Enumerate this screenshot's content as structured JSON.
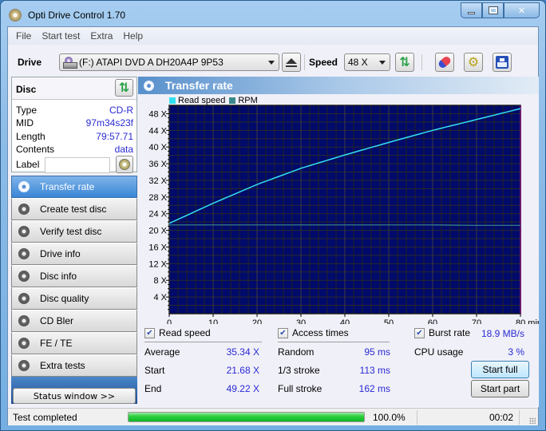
{
  "window": {
    "title": "Opti Drive Control 1.70",
    "controls": {
      "minimize": "minimize",
      "maximize": "maximize",
      "close": "close"
    }
  },
  "menu": [
    "File",
    "Start test",
    "Extra",
    "Help"
  ],
  "toolbar": {
    "drive_label": "Drive",
    "drive_value": "(F:)   ATAPI DVD A  DH20A4P 9P53",
    "speed_label": "Speed",
    "speed_value": "48 X",
    "icons": [
      "eject-icon",
      "refresh-icon",
      "erase-icon",
      "settings-icon",
      "save-icon"
    ]
  },
  "disc": {
    "header": "Disc",
    "fields": [
      {
        "key": "Type",
        "value": "CD-R"
      },
      {
        "key": "MID",
        "value": "97m34s23f"
      },
      {
        "key": "Length",
        "value": "79:57.71"
      },
      {
        "key": "Contents",
        "value": "data"
      }
    ],
    "label_key": "Label",
    "label_value": ""
  },
  "nav": [
    {
      "label": "Transfer rate",
      "active": true
    },
    {
      "label": "Create test disc",
      "active": false
    },
    {
      "label": "Verify test disc",
      "active": false
    },
    {
      "label": "Drive info",
      "active": false
    },
    {
      "label": "Disc info",
      "active": false
    },
    {
      "label": "Disc quality",
      "active": false
    },
    {
      "label": "CD Bler",
      "active": false
    },
    {
      "label": "FE / TE",
      "active": false
    },
    {
      "label": "Extra tests",
      "active": false
    }
  ],
  "status_window_button": "Status window >>",
  "panel": {
    "title": "Transfer rate"
  },
  "chart_data": {
    "type": "line",
    "title": "Transfer rate",
    "xlabel": "min",
    "ylabel": "",
    "xlim": [
      0,
      80
    ],
    "ylim": [
      0,
      50
    ],
    "x_ticks": [
      0,
      10,
      20,
      30,
      40,
      50,
      60,
      70,
      80
    ],
    "x_tick_labels": [
      "0",
      "10",
      "20",
      "30",
      "40",
      "50",
      "60",
      "70",
      "80 min"
    ],
    "y_ticks": [
      4,
      8,
      12,
      16,
      20,
      24,
      28,
      32,
      36,
      40,
      44,
      48
    ],
    "y_tick_labels": [
      "4 X",
      "8 X",
      "12 X",
      "16 X",
      "20 X",
      "24 X",
      "28 X",
      "32 X",
      "36 X",
      "40 X",
      "44 X",
      "48 X"
    ],
    "grid": true,
    "legend_position": "top-left",
    "series": [
      {
        "name": "Read speed",
        "color": "#33e0f0",
        "x": [
          0,
          10,
          20,
          30,
          40,
          50,
          60,
          70,
          80
        ],
        "values": [
          21.68,
          26.5,
          31.0,
          34.9,
          38.1,
          41.1,
          44.0,
          46.6,
          49.22
        ]
      },
      {
        "name": "RPM",
        "color": "#3a8a8a",
        "x": [
          0,
          10,
          20,
          30,
          40,
          50,
          60,
          70,
          80
        ],
        "values": [
          21.3,
          21.3,
          21.3,
          21.3,
          21.3,
          21.3,
          21.3,
          21.2,
          21.2
        ]
      }
    ]
  },
  "stats": {
    "read_speed": {
      "label": "Read speed",
      "checked": true,
      "rows": [
        {
          "key": "Average",
          "value": "35.34 X"
        },
        {
          "key": "Start",
          "value": "21.68 X"
        },
        {
          "key": "End",
          "value": "49.22 X"
        }
      ]
    },
    "access_times": {
      "label": "Access times",
      "checked": true,
      "rows": [
        {
          "key": "Random",
          "value": "95 ms"
        },
        {
          "key": "1/3 stroke",
          "value": "113 ms"
        },
        {
          "key": "Full stroke",
          "value": "162 ms"
        }
      ]
    },
    "burst_rate": {
      "label": "Burst rate",
      "checked": true,
      "value": "18.9 MB/s"
    },
    "cpu_usage": {
      "label": "CPU usage",
      "value": "3 %"
    },
    "buttons": {
      "start_full": "Start full",
      "start_part": "Start part"
    }
  },
  "statusbar": {
    "text": "Test completed",
    "progress": 1.0,
    "progress_text": "100.0%",
    "elapsed": "00:02"
  }
}
